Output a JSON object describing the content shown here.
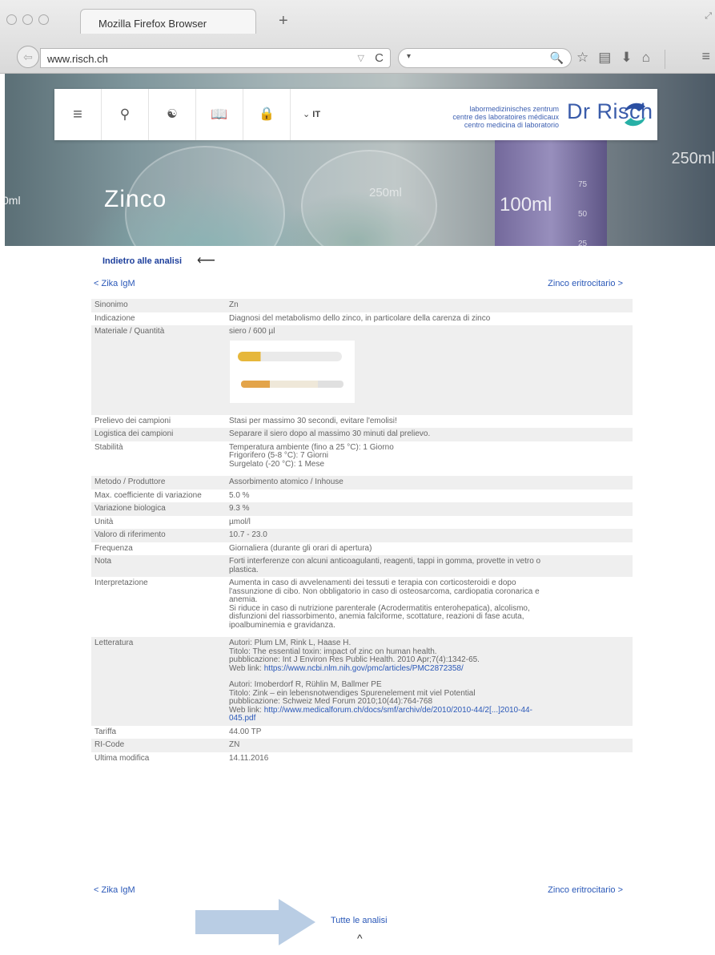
{
  "browser": {
    "tab_title": "Mozilla Firefox Browser",
    "new_tab": "+",
    "url": "www.risch.ch",
    "url_dropdown": "▽",
    "reload": "C",
    "search_dropdown": "▾",
    "search_icon": "magnifier-icon"
  },
  "header": {
    "language": "IT",
    "tagline": [
      "labormedizinisches zentrum",
      "centre des laboratoires médicaux",
      "centro medicina di laboratorio"
    ],
    "brand": "Dr Risch"
  },
  "hero": {
    "title": "Zinco",
    "decor_texts": [
      "250ml",
      "100ml",
      "250ml",
      "0ml"
    ],
    "scale_marks": [
      "75",
      "50",
      "25"
    ]
  },
  "nav": {
    "back_label": "Indietro alle analisi",
    "back_arrow": "⟵",
    "prev": "< Zika IgM",
    "next": "Zinco eritrocitario >",
    "all": "Tutte le analisi",
    "top_caret": "^"
  },
  "rows": [
    {
      "key": "Sinonimo",
      "lines": [
        "Zn"
      ]
    },
    {
      "key": "Indicazione",
      "lines": [
        "Diagnosi del metabolismo dello zinco, in particolare della carenza di zinco"
      ]
    },
    {
      "key": "Materiale / Quantità",
      "lines": [
        "siero / 600 µl"
      ]
    },
    {
      "key": "Prelievo dei campioni",
      "lines": [
        "Stasi per massimo 30 secondi, evitare l'emolisi!"
      ]
    },
    {
      "key": "Logistica dei campioni",
      "lines": [
        "Separare il siero dopo al massimo 30 minuti dal prelievo."
      ]
    },
    {
      "key": "Stabilità",
      "lines": [
        "Temperatura ambiente (fino a 25 °C): 1 Giorno",
        "Frigorifero (5-8 °C): 7 Giorni",
        "Surgelato (-20 °C): 1 Mese"
      ]
    },
    {
      "key": "Metodo / Produttore",
      "lines": [
        "Assorbimento atomico / Inhouse"
      ]
    },
    {
      "key": "Max. coefficiente di variazione",
      "lines": [
        "5.0 %"
      ]
    },
    {
      "key": "Variazione biologica",
      "lines": [
        "9.3 %"
      ]
    },
    {
      "key": "Unità",
      "lines": [
        "µmol/l"
      ]
    },
    {
      "key": "Valoro di riferimento",
      "lines": [
        "10.7 - 23.0"
      ]
    },
    {
      "key": "Frequenza",
      "lines": [
        "Giornaliera (durante gli orari di apertura)"
      ]
    },
    {
      "key": "Nota",
      "lines": [
        "Forti interferenze con alcuni anticoagulanti, reagenti, tappi in gomma, provette in vetro o",
        "plastica."
      ]
    },
    {
      "key": "Interpretazione",
      "lines": [
        "Aumenta in caso di avvelenamenti dei tessuti e terapia con corticosteroidi e dopo",
        "l'assunzione di cibo. Non obbligatorio in caso di osteosarcoma, cardiopatia coronarica e",
        "anemia.",
        "Si riduce in caso di nutrizione parenterale (Acrodermatitis enterohepatica), alcolismo,",
        "disfunzioni del riassorbimento, anemia falciforme, scottature, reazioni di fase acuta,",
        "ipoalbuminemia e gravidanza."
      ]
    },
    {
      "key": "Letteratura",
      "refs": [
        {
          "authors": "Autori: Plum LM, Rink L, Haase H.",
          "title": "Titolo: The essential toxin: impact of zinc on human health.",
          "pub": "pubblicazione: Int J Environ Res Public Health. 2010 Apr;7(4):1342-65.",
          "web_label": "Web link: ",
          "web_url": "https://www.ncbi.nlm.nih.gov/pmc/articles/PMC2872358/",
          "web_url2": ""
        },
        {
          "authors": "Autori: Imoberdorf R, Rühlin M, Ballmer PE",
          "title": "Titolo: Zink – ein lebensnotwendiges Spurenelement mit viel Potential",
          "pub": "pubblicazione: Schweiz Med Forum 2010;10(44):764-768",
          "web_label": "Web link: ",
          "web_url": "http://www.medicalforum.ch/docs/smf/archiv/de/2010/2010-44/2[...]2010-44-",
          "web_url2": "045.pdf"
        }
      ]
    },
    {
      "key": "Tariffa",
      "lines": [
        "44.00 TP"
      ]
    },
    {
      "key": "RI-Code",
      "lines": [
        "ZN"
      ]
    },
    {
      "key": "Ultima modifica",
      "lines": [
        "14.11.2016"
      ]
    }
  ]
}
